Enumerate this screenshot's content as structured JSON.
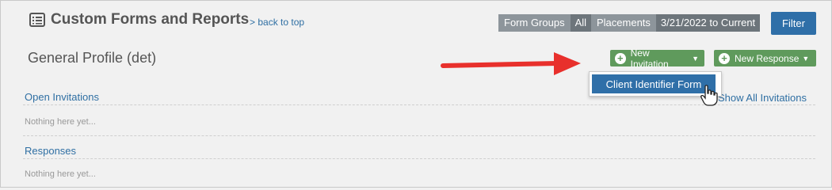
{
  "header": {
    "title": "Custom Forms and Reports",
    "back_link": "> back to top",
    "form_groups_label": "Form Groups",
    "form_groups_value": "All",
    "placements_label": "Placements",
    "placements_value": "3/21/2022 to Current",
    "filter_label": "Filter",
    "icon": "list-form-icon"
  },
  "section": {
    "title": "General Profile (det)",
    "new_invitation_label": "New Invitation",
    "new_response_label": "New Response"
  },
  "dropdown": {
    "items": [
      "Client Identifier Form"
    ]
  },
  "lists": {
    "open_invitations_label": "Open Invitations",
    "open_invitations_empty": "Nothing here yet...",
    "show_all_invitations": "Show All Invitations",
    "responses_label": "Responses",
    "responses_empty": "Nothing here yet..."
  },
  "colors": {
    "accent_blue": "#2f6fa8",
    "green_button": "#5f9a5c",
    "annotation_red": "#e8302c"
  }
}
